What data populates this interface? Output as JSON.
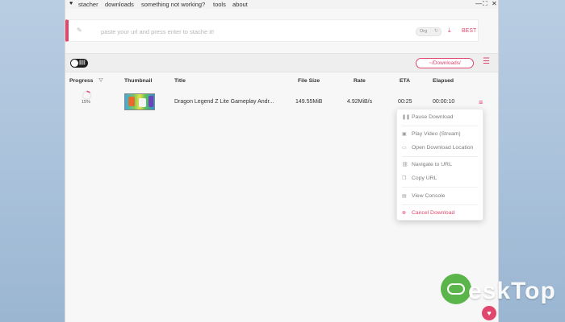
{
  "menubar": {
    "items": [
      "stacher",
      "downloads",
      "something not working?",
      "tools",
      "about"
    ],
    "window_controls": [
      "—",
      "⛶",
      "✕"
    ]
  },
  "urlbar": {
    "placeholder": "paste your url and press enter to stache it!",
    "cookie_label": "Org",
    "quality_label": "BEST"
  },
  "toolbar": {
    "path_label": "~/Downloads/"
  },
  "table": {
    "headers": [
      "Progress",
      "Thumbnail",
      "Title",
      "File Size",
      "Rate",
      "ETA",
      "Elapsed"
    ],
    "rows": [
      {
        "progress": "15%",
        "title": "Dragon Legend Z Lite Gameplay Andr...",
        "file_size": "149.55MiB",
        "rate": "4.92MiB/s",
        "eta": "00:25",
        "elapsed": "00:00:10"
      }
    ]
  },
  "context_menu": {
    "items": [
      {
        "label": "Pause Download",
        "icon": "pause-icon"
      },
      {
        "label": "Play Video (Stream)",
        "icon": "play-icon"
      },
      {
        "label": "Open Download Location",
        "icon": "folder-icon"
      },
      {
        "label": "Navigate to URL",
        "icon": "link-icon"
      },
      {
        "label": "Copy URL",
        "icon": "copy-icon"
      },
      {
        "label": "View Console",
        "icon": "console-icon"
      },
      {
        "label": "Cancel Download",
        "icon": "cancel-icon"
      }
    ]
  },
  "watermark": {
    "text": "eskTop"
  },
  "colors": {
    "accent": "#e0476e"
  }
}
